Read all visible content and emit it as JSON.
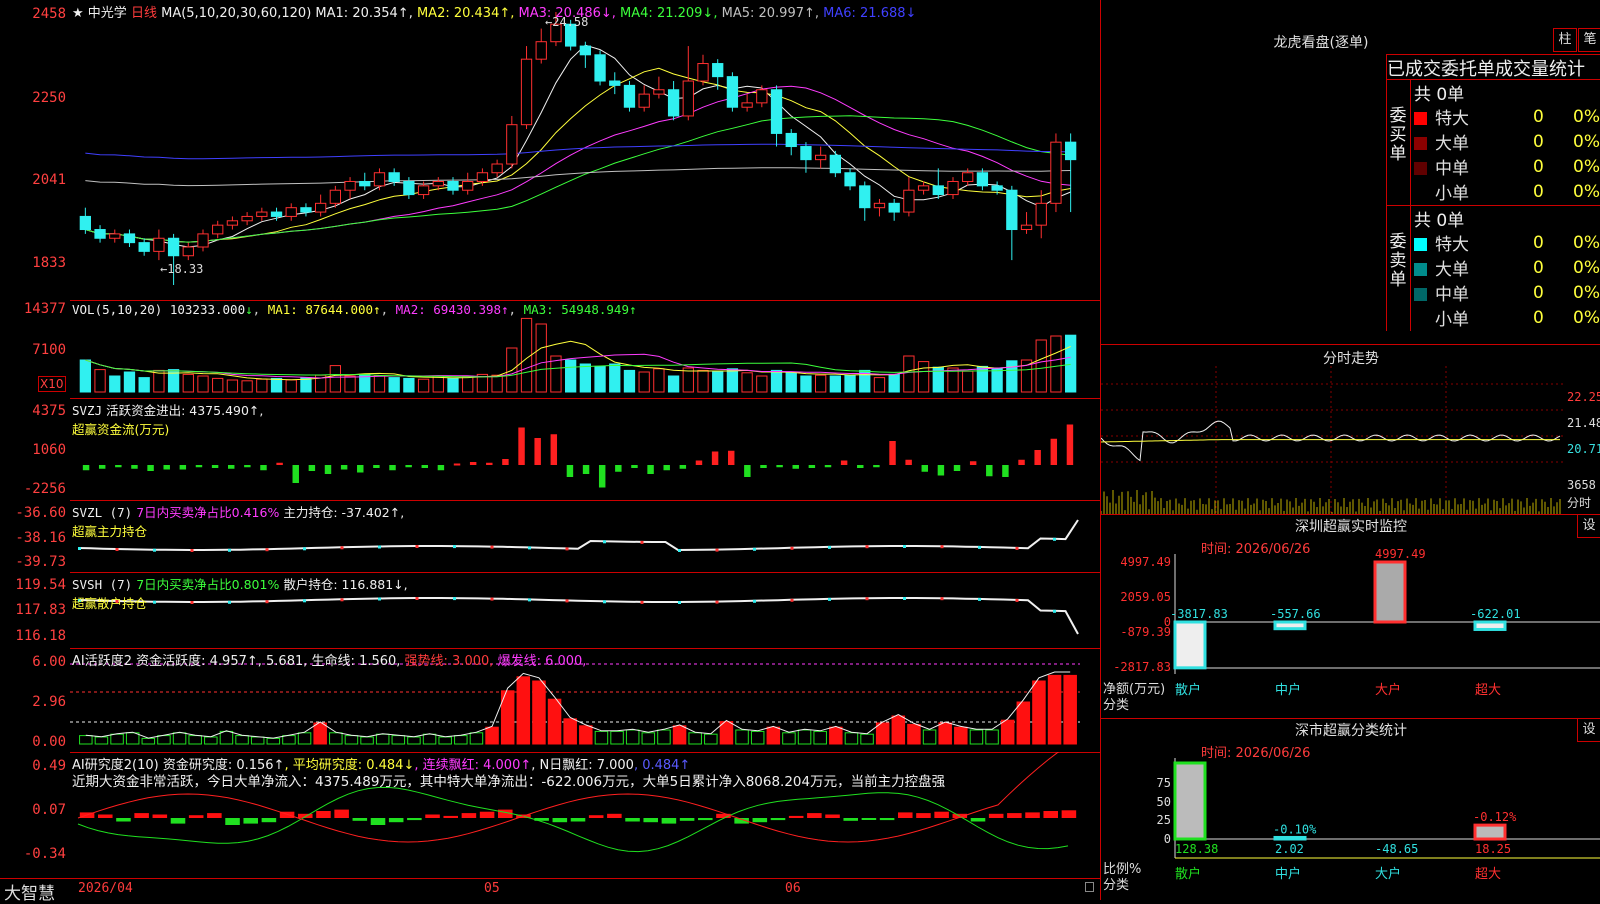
{
  "stock": {
    "name": "中光学",
    "period": "日线",
    "ma_title": "MA(5,10,20,30,60,120)",
    "ma_values": [
      {
        "label": "MA1: 20.354",
        "arrow": "↑",
        "color": "#f0f0f0"
      },
      {
        "label": "MA2: 20.434",
        "arrow": "↑",
        "color": "#ffff3c"
      },
      {
        "label": "MA3: 20.486",
        "arrow": "↓",
        "color": "#ff3cff"
      },
      {
        "label": "MA4: 21.209",
        "arrow": "↓",
        "color": "#3cff3c"
      },
      {
        "label": "MA5: 20.997",
        "arrow": "↑",
        "color": "#c0c0c0"
      },
      {
        "label": "MA6: 21.688",
        "arrow": "↓",
        "color": "#4040ff"
      }
    ],
    "high_mark": "24.58",
    "low_mark": "←18.33",
    "price_axis": [
      "2458",
      "2250",
      "2041",
      "1833"
    ]
  },
  "volume": {
    "title": "VOL(5,10,20)",
    "value": "103233.000",
    "value_arrow": "↓",
    "ma1": "MA1: 87644.000↑",
    "ma2": "MA2: 69430.398↑",
    "ma3": "MA3: 54948.949↑",
    "axis": [
      "14377",
      "7100"
    ],
    "unit": "X10"
  },
  "svzj": {
    "title": "SVZJ",
    "label": "活跃资金进出: 4375.490↑,",
    "sub": "超赢资金流(万元)",
    "axis": [
      "4375",
      "1060",
      "-2256"
    ]
  },
  "svzl": {
    "title": "SVZL (7)",
    "pct": "7日内买卖净占比0.416%",
    "label": "主力持仓: -37.402↑,",
    "sub": "超赢主力持仓",
    "axis": [
      "-36.60",
      "-38.16",
      "-39.73"
    ]
  },
  "svsh": {
    "title": "SVSH (7)",
    "pct": "7日内买卖净占比0.801%",
    "label": "散户持仓: 116.881↓,",
    "sub": "超赢散户持仓",
    "axis": [
      "119.54",
      "117.83",
      "116.18"
    ]
  },
  "ai1": {
    "title": "AI活跃度2",
    "label1": "资金活跃度: 4.957↑",
    "label2": ", 5.681,",
    "label3": "生命线: 1.560,",
    "label4": "强势线: 3.000,",
    "label5": "爆发线: 6.000,",
    "axis": [
      "6.00",
      "2.96",
      "0.00"
    ]
  },
  "ai2": {
    "title": "AI研究度2(10)",
    "label1": "资金研究度: 0.156↑",
    "label2": ", 平均研究度: 0.484↓",
    "label3": ", 连续飘红: 4.000↑",
    "label4": ", N日飘红: 7.000",
    "label5": ", 0.484↑",
    "commentary": "近期大资金非常活跃，今日大单净流入：4375.489万元，其中特大单净流出：-622.006万元，大单5日累计净入8068.204万元，当前主力控盘强",
    "axis": [
      "0.49",
      "0.07",
      "-0.34"
    ]
  },
  "footer": {
    "brand": "大智慧",
    "date_labels": [
      "2026/04",
      "05",
      "06"
    ]
  },
  "dragon": {
    "title": "龙虎看盘(逐单)",
    "btn_zhu": "柱",
    "btn_bi": "笔",
    "subtitle": "已成交委托单成交量统计",
    "buy_label": "委买单",
    "sell_label": "委卖单",
    "buy_total": "共 0单",
    "sell_total": "共 0单",
    "buy_rows": [
      {
        "name": "特大",
        "val": "0",
        "pct": "0%",
        "color": "#ff0000"
      },
      {
        "name": "大单",
        "val": "0",
        "pct": "0%",
        "color": "#8b0000"
      },
      {
        "name": "中单",
        "val": "0",
        "pct": "0%",
        "color": "#600000"
      },
      {
        "name": "小单",
        "val": "0",
        "pct": "0%",
        "color": ""
      }
    ],
    "sell_rows": [
      {
        "name": "特大",
        "val": "0",
        "pct": "0%",
        "color": "#00ffff"
      },
      {
        "name": "大单",
        "val": "0",
        "pct": "0%",
        "color": "#008b8b"
      },
      {
        "name": "中单",
        "val": "0",
        "pct": "0%",
        "color": "#006868"
      },
      {
        "name": "小单",
        "val": "0",
        "pct": "0%",
        "color": ""
      }
    ]
  },
  "intraday": {
    "title": "分时走势",
    "axis": [
      "22.25",
      "21.48",
      "20.71"
    ],
    "vol_label": "3658",
    "vol_unit": "分时"
  },
  "monitor": {
    "title": "深圳超赢实时监控",
    "btn": "设",
    "time": "时间: 2026/06/26",
    "axis": [
      "4997.49",
      "2059.05",
      "0",
      "-879.39",
      "-2817.83"
    ],
    "axis_title": "净额(万元)",
    "axis_sub": "分类",
    "categories": [
      "散户",
      "中户",
      "大户",
      "超大"
    ],
    "bar_values": [
      -3817.83,
      -557.66,
      4997.49,
      -622.01
    ],
    "bar_labels": [
      "-3817.83",
      "-557.66",
      "4997.49",
      "-622.01"
    ]
  },
  "classify": {
    "title": "深市超赢分类统计",
    "btn": "设",
    "time": "时间: 2026/06/26",
    "axis": [
      "75",
      "50",
      "25",
      "0"
    ],
    "axis_title": "比例%",
    "axis_sub": "分类",
    "categories": [
      "散户",
      "中户",
      "大户",
      "超大"
    ],
    "values": [
      "128.38",
      "2.02",
      "-48.65",
      "18.25"
    ],
    "pct_labels": [
      "",
      "-0.10%",
      "",
      "-0.12%"
    ]
  },
  "chart_data": {
    "type": "candlestick",
    "ylim": [
      18.33,
      24.58
    ],
    "candles": [
      [
        19.9,
        19.6,
        20.1,
        19.5
      ],
      [
        19.6,
        19.4,
        19.7,
        19.3
      ],
      [
        19.4,
        19.5,
        19.6,
        19.3
      ],
      [
        19.5,
        19.3,
        19.6,
        19.2
      ],
      [
        19.3,
        19.1,
        19.4,
        19.0
      ],
      [
        19.1,
        19.4,
        19.6,
        18.9
      ],
      [
        19.4,
        19.0,
        19.5,
        18.33
      ],
      [
        19.0,
        19.2,
        19.3,
        18.9
      ],
      [
        19.2,
        19.5,
        19.6,
        19.1
      ],
      [
        19.5,
        19.7,
        19.8,
        19.4
      ],
      [
        19.7,
        19.8,
        19.9,
        19.6
      ],
      [
        19.8,
        19.9,
        20.0,
        19.7
      ],
      [
        19.9,
        20.0,
        20.1,
        19.8
      ],
      [
        20.0,
        19.9,
        20.1,
        19.8
      ],
      [
        19.9,
        20.1,
        20.2,
        19.8
      ],
      [
        20.1,
        20.0,
        20.2,
        19.9
      ],
      [
        20.0,
        20.2,
        20.4,
        19.9
      ],
      [
        20.2,
        20.5,
        20.6,
        20.1
      ],
      [
        20.5,
        20.7,
        20.8,
        20.3
      ],
      [
        20.7,
        20.6,
        20.9,
        20.5
      ],
      [
        20.6,
        20.9,
        21.0,
        20.5
      ],
      [
        20.9,
        20.7,
        21.0,
        20.6
      ],
      [
        20.7,
        20.4,
        20.8,
        20.3
      ],
      [
        20.4,
        20.6,
        20.7,
        20.3
      ],
      [
        20.6,
        20.7,
        20.8,
        20.5
      ],
      [
        20.7,
        20.5,
        20.8,
        20.4
      ],
      [
        20.5,
        20.7,
        20.9,
        20.4
      ],
      [
        20.7,
        20.9,
        21.0,
        20.6
      ],
      [
        20.9,
        21.1,
        21.2,
        20.8
      ],
      [
        21.1,
        22.0,
        22.2,
        21.0
      ],
      [
        22.0,
        23.5,
        23.8,
        21.9
      ],
      [
        23.5,
        23.9,
        24.2,
        23.4
      ],
      [
        23.9,
        24.3,
        24.58,
        23.8
      ],
      [
        24.3,
        23.8,
        24.4,
        23.7
      ],
      [
        23.8,
        23.6,
        23.9,
        23.3
      ],
      [
        23.6,
        23.0,
        23.7,
        22.9
      ],
      [
        23.0,
        22.9,
        23.2,
        22.7
      ],
      [
        22.9,
        22.4,
        23.0,
        22.3
      ],
      [
        22.4,
        22.7,
        22.9,
        22.3
      ],
      [
        22.7,
        22.8,
        23.1,
        22.6
      ],
      [
        22.8,
        22.2,
        23.0,
        22.1
      ],
      [
        22.2,
        23.0,
        23.8,
        22.1
      ],
      [
        23.0,
        23.4,
        23.6,
        22.9
      ],
      [
        23.4,
        23.1,
        23.5,
        22.8
      ],
      [
        23.1,
        22.4,
        23.2,
        22.3
      ],
      [
        22.4,
        22.5,
        22.7,
        22.3
      ],
      [
        22.5,
        22.8,
        22.9,
        22.4
      ],
      [
        22.8,
        21.8,
        22.9,
        21.5
      ],
      [
        21.8,
        21.5,
        21.9,
        21.3
      ],
      [
        21.5,
        21.2,
        21.6,
        20.9
      ],
      [
        21.2,
        21.3,
        21.5,
        21.0
      ],
      [
        21.3,
        20.9,
        21.4,
        20.8
      ],
      [
        20.9,
        20.6,
        21.0,
        20.5
      ],
      [
        20.6,
        20.1,
        20.7,
        19.8
      ],
      [
        20.1,
        20.2,
        20.3,
        19.9
      ],
      [
        20.2,
        20.0,
        20.3,
        19.8
      ],
      [
        20.0,
        20.5,
        20.8,
        19.9
      ],
      [
        20.5,
        20.6,
        20.7,
        20.4
      ],
      [
        20.6,
        20.4,
        21.0,
        20.3
      ],
      [
        20.4,
        20.7,
        20.8,
        20.3
      ],
      [
        20.7,
        20.9,
        21.0,
        20.6
      ],
      [
        20.9,
        20.6,
        21.0,
        20.5
      ],
      [
        20.6,
        20.5,
        20.7,
        20.4
      ],
      [
        20.5,
        19.6,
        20.6,
        18.9
      ],
      [
        19.6,
        19.7,
        20.0,
        19.5
      ],
      [
        19.7,
        20.2,
        20.5,
        19.4
      ],
      [
        20.2,
        21.6,
        21.8,
        20.0
      ],
      [
        21.6,
        21.2,
        21.8,
        20.0
      ]
    ],
    "volume_bars": [
      0.4,
      0.28,
      0.2,
      0.25,
      0.18,
      0.27,
      0.28,
      0.22,
      0.2,
      0.17,
      0.15,
      0.14,
      0.16,
      0.17,
      0.15,
      0.18,
      0.21,
      0.33,
      0.2,
      0.22,
      0.2,
      0.18,
      0.17,
      0.16,
      0.2,
      0.17,
      0.2,
      0.22,
      0.21,
      0.55,
      0.92,
      0.85,
      0.45,
      0.4,
      0.35,
      0.32,
      0.35,
      0.27,
      0.25,
      0.29,
      0.2,
      0.3,
      0.27,
      0.25,
      0.29,
      0.24,
      0.2,
      0.27,
      0.24,
      0.2,
      0.21,
      0.2,
      0.21,
      0.27,
      0.18,
      0.22,
      0.45,
      0.38,
      0.31,
      0.3,
      0.26,
      0.32,
      0.3,
      0.39,
      0.4,
      0.65,
      0.7,
      0.71
    ],
    "volume_up": [
      0,
      1,
      0,
      0,
      0,
      1,
      0,
      1,
      1,
      1,
      1,
      1,
      1,
      0,
      1,
      0,
      1,
      1,
      1,
      0,
      1,
      0,
      0,
      1,
      1,
      0,
      1,
      1,
      1,
      1,
      1,
      1,
      1,
      0,
      0,
      0,
      0,
      0,
      1,
      1,
      0,
      1,
      1,
      0,
      0,
      1,
      1,
      0,
      0,
      0,
      1,
      0,
      0,
      0,
      1,
      0,
      1,
      1,
      0,
      1,
      1,
      0,
      0,
      0,
      1,
      1,
      1,
      0
    ],
    "svzj_bars": [
      -0.35,
      -0.25,
      -0.15,
      -0.25,
      -0.4,
      -0.3,
      -0.3,
      -0.15,
      -0.2,
      -0.25,
      -0.15,
      -0.35,
      0.15,
      -1.2,
      -0.4,
      -0.6,
      -0.3,
      -0.5,
      -0.2,
      -0.35,
      -0.15,
      -0.2,
      -0.35,
      0.1,
      0.2,
      0.15,
      0.4,
      2.5,
      1.8,
      2.05,
      -0.8,
      -0.6,
      -1.5,
      -0.45,
      -0.2,
      -0.6,
      -0.35,
      -0.25,
      0.3,
      0.9,
      0.95,
      -0.8,
      -0.2,
      -0.15,
      -0.25,
      -0.2,
      -0.15,
      0.3,
      -0.2,
      -0.15,
      1.6,
      0.35,
      -0.45,
      -0.7,
      -0.4,
      0.25,
      -0.75,
      -0.8,
      0.35,
      1.0,
      1.75,
      2.7
    ],
    "ai1_bars": [
      0.6,
      0.5,
      0.7,
      0.8,
      0.4,
      0.6,
      0.8,
      0.6,
      0.5,
      0.9,
      0.6,
      0.5,
      0.4,
      0.6,
      0.8,
      1.5,
      0.8,
      0.6,
      0.5,
      0.7,
      0.6,
      0.5,
      0.7,
      0.5,
      0.6,
      0.8,
      1.2,
      3.8,
      4.8,
      4.5,
      3.2,
      1.8,
      1.3,
      0.9,
      0.9,
      1.0,
      0.8,
      1.0,
      1.3,
      0.8,
      0.7,
      1.6,
      1.0,
      0.9,
      1.2,
      0.8,
      1.0,
      0.9,
      1.2,
      0.8,
      0.7,
      1.5,
      2.0,
      1.4,
      1.0,
      1.5,
      1.2,
      1.0,
      1.0,
      1.7,
      3.0,
      4.5,
      4.9,
      4.9
    ],
    "ai2_bars": [
      0.08,
      0.05,
      -0.05,
      0.07,
      0.05,
      -0.08,
      0.04,
      0.07,
      -0.1,
      -0.08,
      -0.06,
      0.09,
      0.06,
      0.1,
      0.12,
      -0.04,
      -0.1,
      -0.06,
      -0.03,
      0.05,
      0.03,
      0.07,
      0.09,
      0.12,
      0.05,
      -0.04,
      -0.06,
      -0.05,
      0.04,
      0.06,
      -0.05,
      -0.06,
      -0.08,
      -0.04,
      -0.03,
      0.06,
      -0.08,
      -0.06,
      -0.03,
      0.03,
      0.07,
      0.05,
      -0.04,
      -0.02,
      -0.03,
      0.08,
      0.07,
      0.09,
      0.06,
      -0.05,
      0.06,
      0.07,
      0.08,
      0.1,
      0.11
    ]
  }
}
